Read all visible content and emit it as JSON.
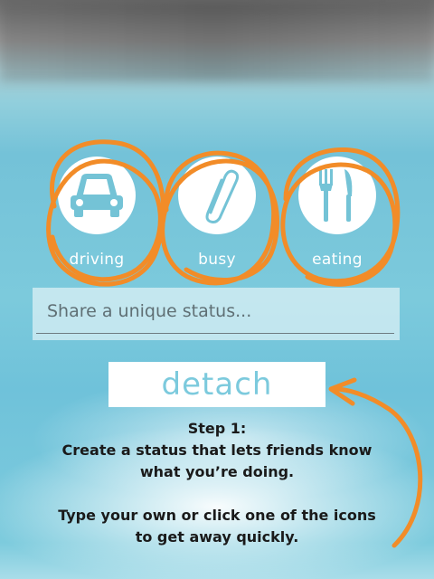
{
  "status_icons": [
    {
      "key": "driving",
      "label": "driving",
      "icon": "car-icon"
    },
    {
      "key": "busy",
      "label": "busy",
      "icon": "paperclip-icon"
    },
    {
      "key": "eating",
      "label": "eating",
      "icon": "fork-knife-icon"
    }
  ],
  "status_input": {
    "placeholder": "Share a unique status...",
    "value": ""
  },
  "detach_button": {
    "label": "detach"
  },
  "tutorial": {
    "step_title": "Step 1:",
    "step_line1": "Create a status that lets friends know",
    "step_line2": "what you’re doing.",
    "tip_line1": "Type your own or click one of the icons",
    "tip_line2": "to get away quickly."
  },
  "colors": {
    "accent": "#7ccadd",
    "annotation": "#f28c28",
    "icon_color": "#74c3d6"
  }
}
